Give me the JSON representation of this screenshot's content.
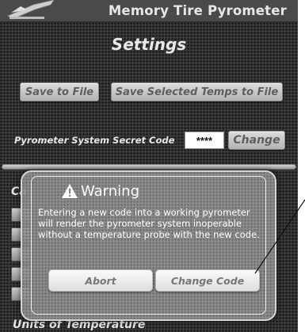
{
  "header": {
    "app_title": "Memory Tire Pyrometer",
    "logo_icon": "pyrometer-logo"
  },
  "settings": {
    "title": "Settings",
    "save_to_file_label": "Save to File",
    "save_selected_temps_label": "Save Selected Temps to File",
    "secret_code_label": "Pyrometer System Secret Code",
    "secret_code_value": "****",
    "change_label": "Change",
    "partial_section_label": "Ca",
    "units_label": "Units of Temperature"
  },
  "dialog": {
    "icon": "warning-icon",
    "title": "Warning",
    "message": "Entering a new code into a working pyrometer will render the pyrometer system inoperable without a temperature probe with the new code.",
    "abort_label": "Abort",
    "change_code_label": "Change Code"
  }
}
